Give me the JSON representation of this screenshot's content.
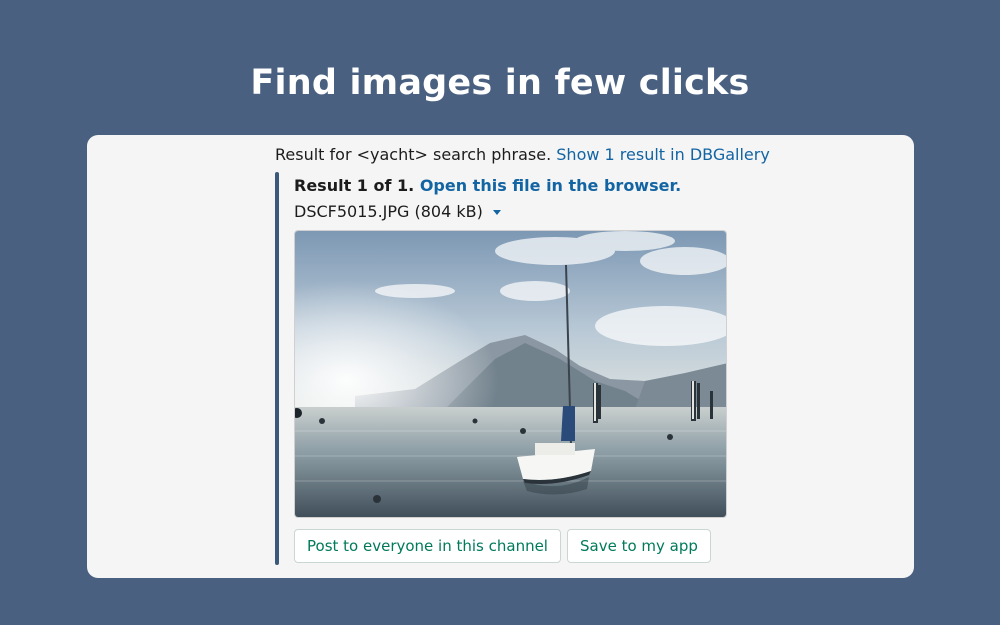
{
  "headline": "Find images in few clicks",
  "message": {
    "search_prefix": "Result for <yacht> search phrase.",
    "show_result_link": "Show 1 result in DBGallery"
  },
  "attachment": {
    "result_label": "Result 1 of 1.",
    "open_link": "Open this file in the browser.",
    "file_label": "DSCF5015.JPG (804 kB)",
    "image_subject": "sailboat on lake with mountains",
    "accent_color": "#3b5a7a",
    "link_color": "#1264a3"
  },
  "actions": {
    "post_label": "Post to everyone in this channel",
    "save_label": "Save to my app",
    "button_text_color": "#007a5a"
  },
  "colors": {
    "background": "#4a6080",
    "card": "#f5f5f5"
  }
}
